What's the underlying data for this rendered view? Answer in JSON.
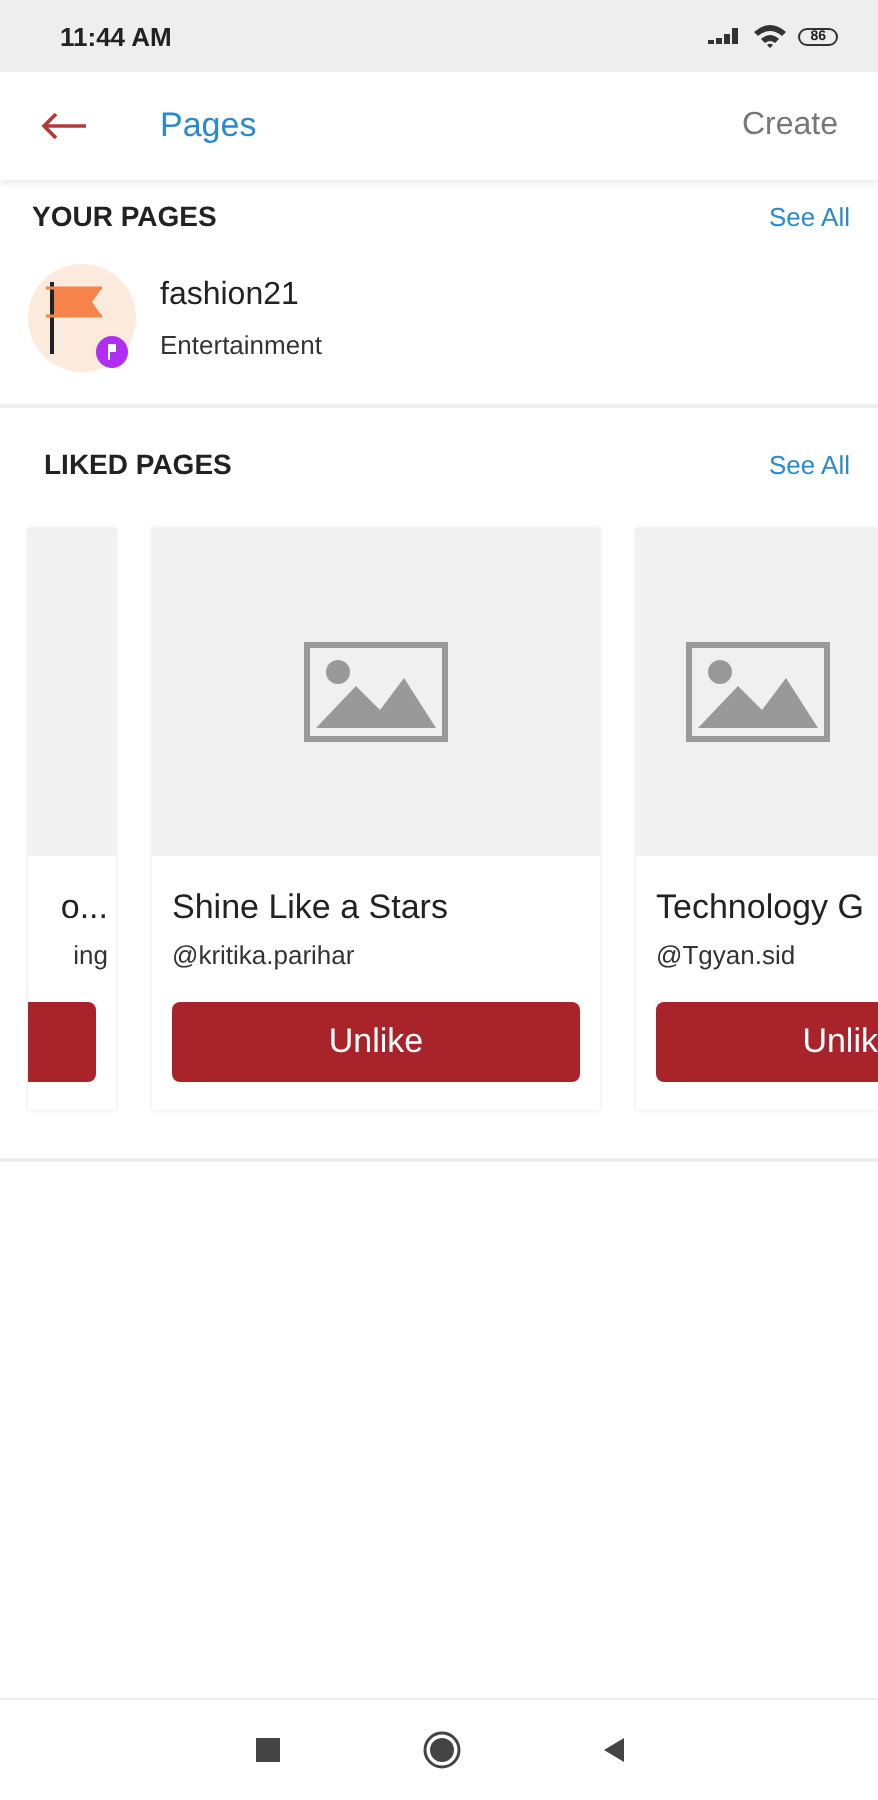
{
  "status_bar": {
    "time": "11:44 AM",
    "battery": "86"
  },
  "header": {
    "title": "Pages",
    "action": "Create"
  },
  "your_pages": {
    "heading": "YOUR PAGES",
    "see_all": "See All",
    "items": [
      {
        "name": "fashion21",
        "category": "Entertainment"
      }
    ]
  },
  "liked_pages": {
    "heading": "LIKED PAGES",
    "see_all": "See All",
    "cards": [
      {
        "kind": "left",
        "name": "o...",
        "handle": "ing"
      },
      {
        "kind": "full",
        "name": "Shine Like a Stars",
        "handle": "@kritika.parihar",
        "button": "Unlike"
      },
      {
        "kind": "right",
        "name": "Technology G",
        "handle": "@Tgyan.sid",
        "button": "Unlik"
      }
    ]
  }
}
